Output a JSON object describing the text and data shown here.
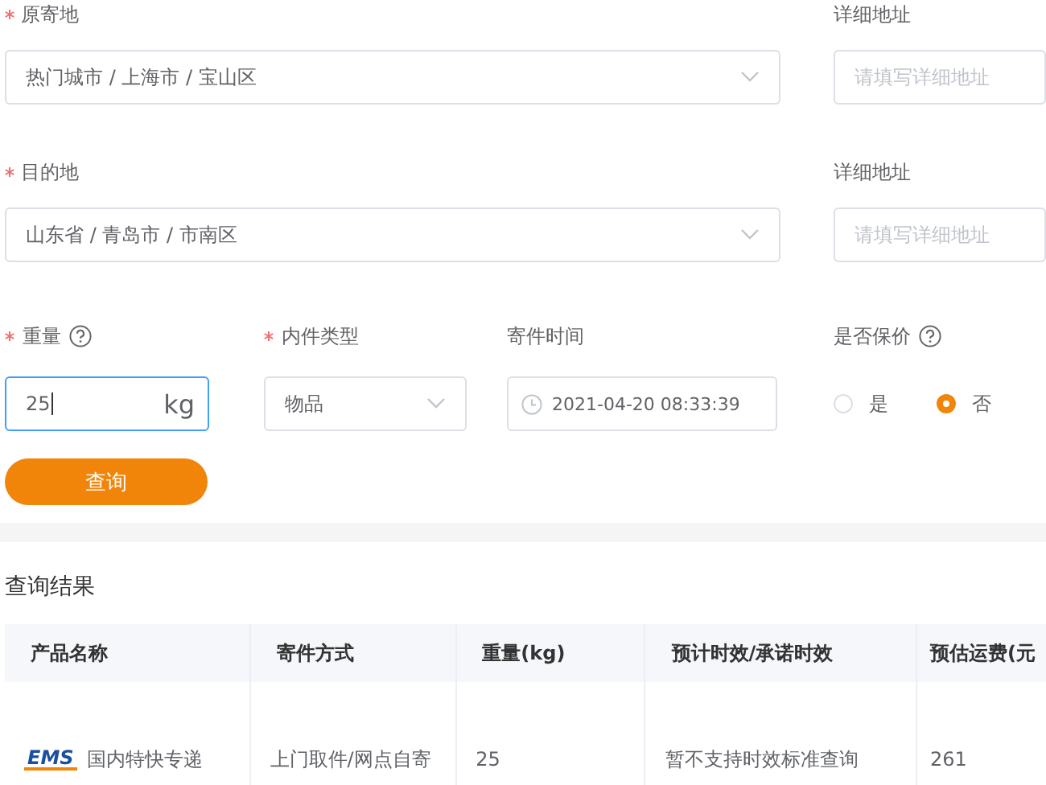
{
  "address_rows": [
    {
      "label": {
        "text": "原寄地",
        "required": true
      },
      "region": "热门城市 / 上海市 / 宝山区",
      "detail_label": "详细地址",
      "detail_placeholder": "请填写详细地址"
    },
    {
      "label": {
        "text": "目的地",
        "required": true
      },
      "region": "山东省 / 青岛市 / 市南区",
      "detail_label": "详细地址",
      "detail_placeholder": "请填写详细地址"
    }
  ],
  "weight": {
    "label": {
      "text": "重量",
      "required": true,
      "help": true
    },
    "value": "25",
    "unit": "kg",
    "focused": true
  },
  "item_type": {
    "label": {
      "text": "内件类型",
      "required": true,
      "help": false
    },
    "value": "物品"
  },
  "send_time": {
    "label": {
      "text": "寄件时间",
      "required": false,
      "help": false
    },
    "value": "2021-04-20 08:33:39"
  },
  "insurance": {
    "label": {
      "text": "是否保价",
      "required": false,
      "help": true
    },
    "options": [
      {
        "label": "是",
        "selected": false
      },
      {
        "label": "否",
        "selected": true
      }
    ]
  },
  "query_button": "查询",
  "results": {
    "title": "查询结果",
    "columns": [
      "产品名称",
      "寄件方式",
      "重量(kg)",
      "预计时效/承诺时效",
      "预估运费(元"
    ],
    "rows": [
      {
        "logo": "EMS",
        "product": "国内特快专递",
        "method": "上门取件/网点自寄",
        "weight": "25",
        "time": "暂不支持时效标准查询",
        "fee": "261"
      }
    ]
  }
}
